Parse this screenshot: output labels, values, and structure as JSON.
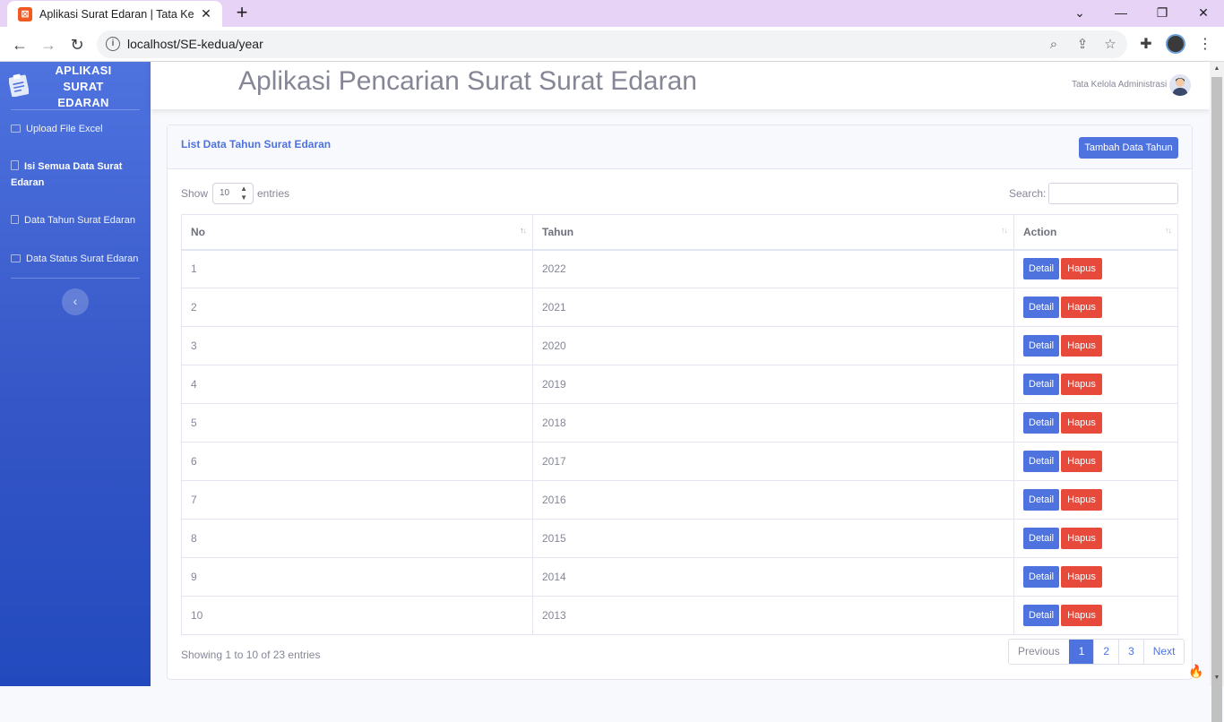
{
  "browser": {
    "tab_title": "Aplikasi Surat Edaran | Tata Kelola",
    "tab_favicon": "xampp-icon",
    "url": "localhost/SE-kedua/year"
  },
  "sidebar": {
    "brand": "APLIKASI SURAT EDARAN",
    "items": [
      {
        "label": "Upload File Excel",
        "icon": "table-icon"
      },
      {
        "label": "Isi Semua Data Surat Edaran",
        "icon": "file-icon",
        "active": true
      },
      {
        "label": "Data Tahun Surat Edaran",
        "icon": "calendar-icon"
      },
      {
        "label": "Data Status Surat Edaran",
        "icon": "table-icon"
      }
    ],
    "toggle": "‹"
  },
  "topbar": {
    "title": "Aplikasi Pencarian Surat Surat Edaran",
    "user_name": "Tata Kelola Administrasi"
  },
  "card": {
    "title": "List Data Tahun Surat Edaran",
    "add_button": "Tambah Data Tahun",
    "show_label": "Show",
    "page_size": "10",
    "entries_label": "entries",
    "search_label": "Search:",
    "search_value": "",
    "columns": [
      "No",
      "Tahun",
      "Action"
    ],
    "rows": [
      {
        "no": "1",
        "tahun": "2022"
      },
      {
        "no": "2",
        "tahun": "2021"
      },
      {
        "no": "3",
        "tahun": "2020"
      },
      {
        "no": "4",
        "tahun": "2019"
      },
      {
        "no": "5",
        "tahun": "2018"
      },
      {
        "no": "6",
        "tahun": "2017"
      },
      {
        "no": "7",
        "tahun": "2016"
      },
      {
        "no": "8",
        "tahun": "2015"
      },
      {
        "no": "9",
        "tahun": "2014"
      },
      {
        "no": "10",
        "tahun": "2013"
      }
    ],
    "detail_label": "Detail",
    "delete_label": "Hapus",
    "info": "Showing 1 to 10 of 23 entries",
    "pagination": {
      "previous": "Previous",
      "pages": [
        "1",
        "2",
        "3"
      ],
      "current": "1",
      "next": "Next"
    }
  },
  "colors": {
    "primary": "#4e73df",
    "danger": "#e74a3b",
    "text_muted": "#858796",
    "tabbar": "#e6d3f5"
  }
}
